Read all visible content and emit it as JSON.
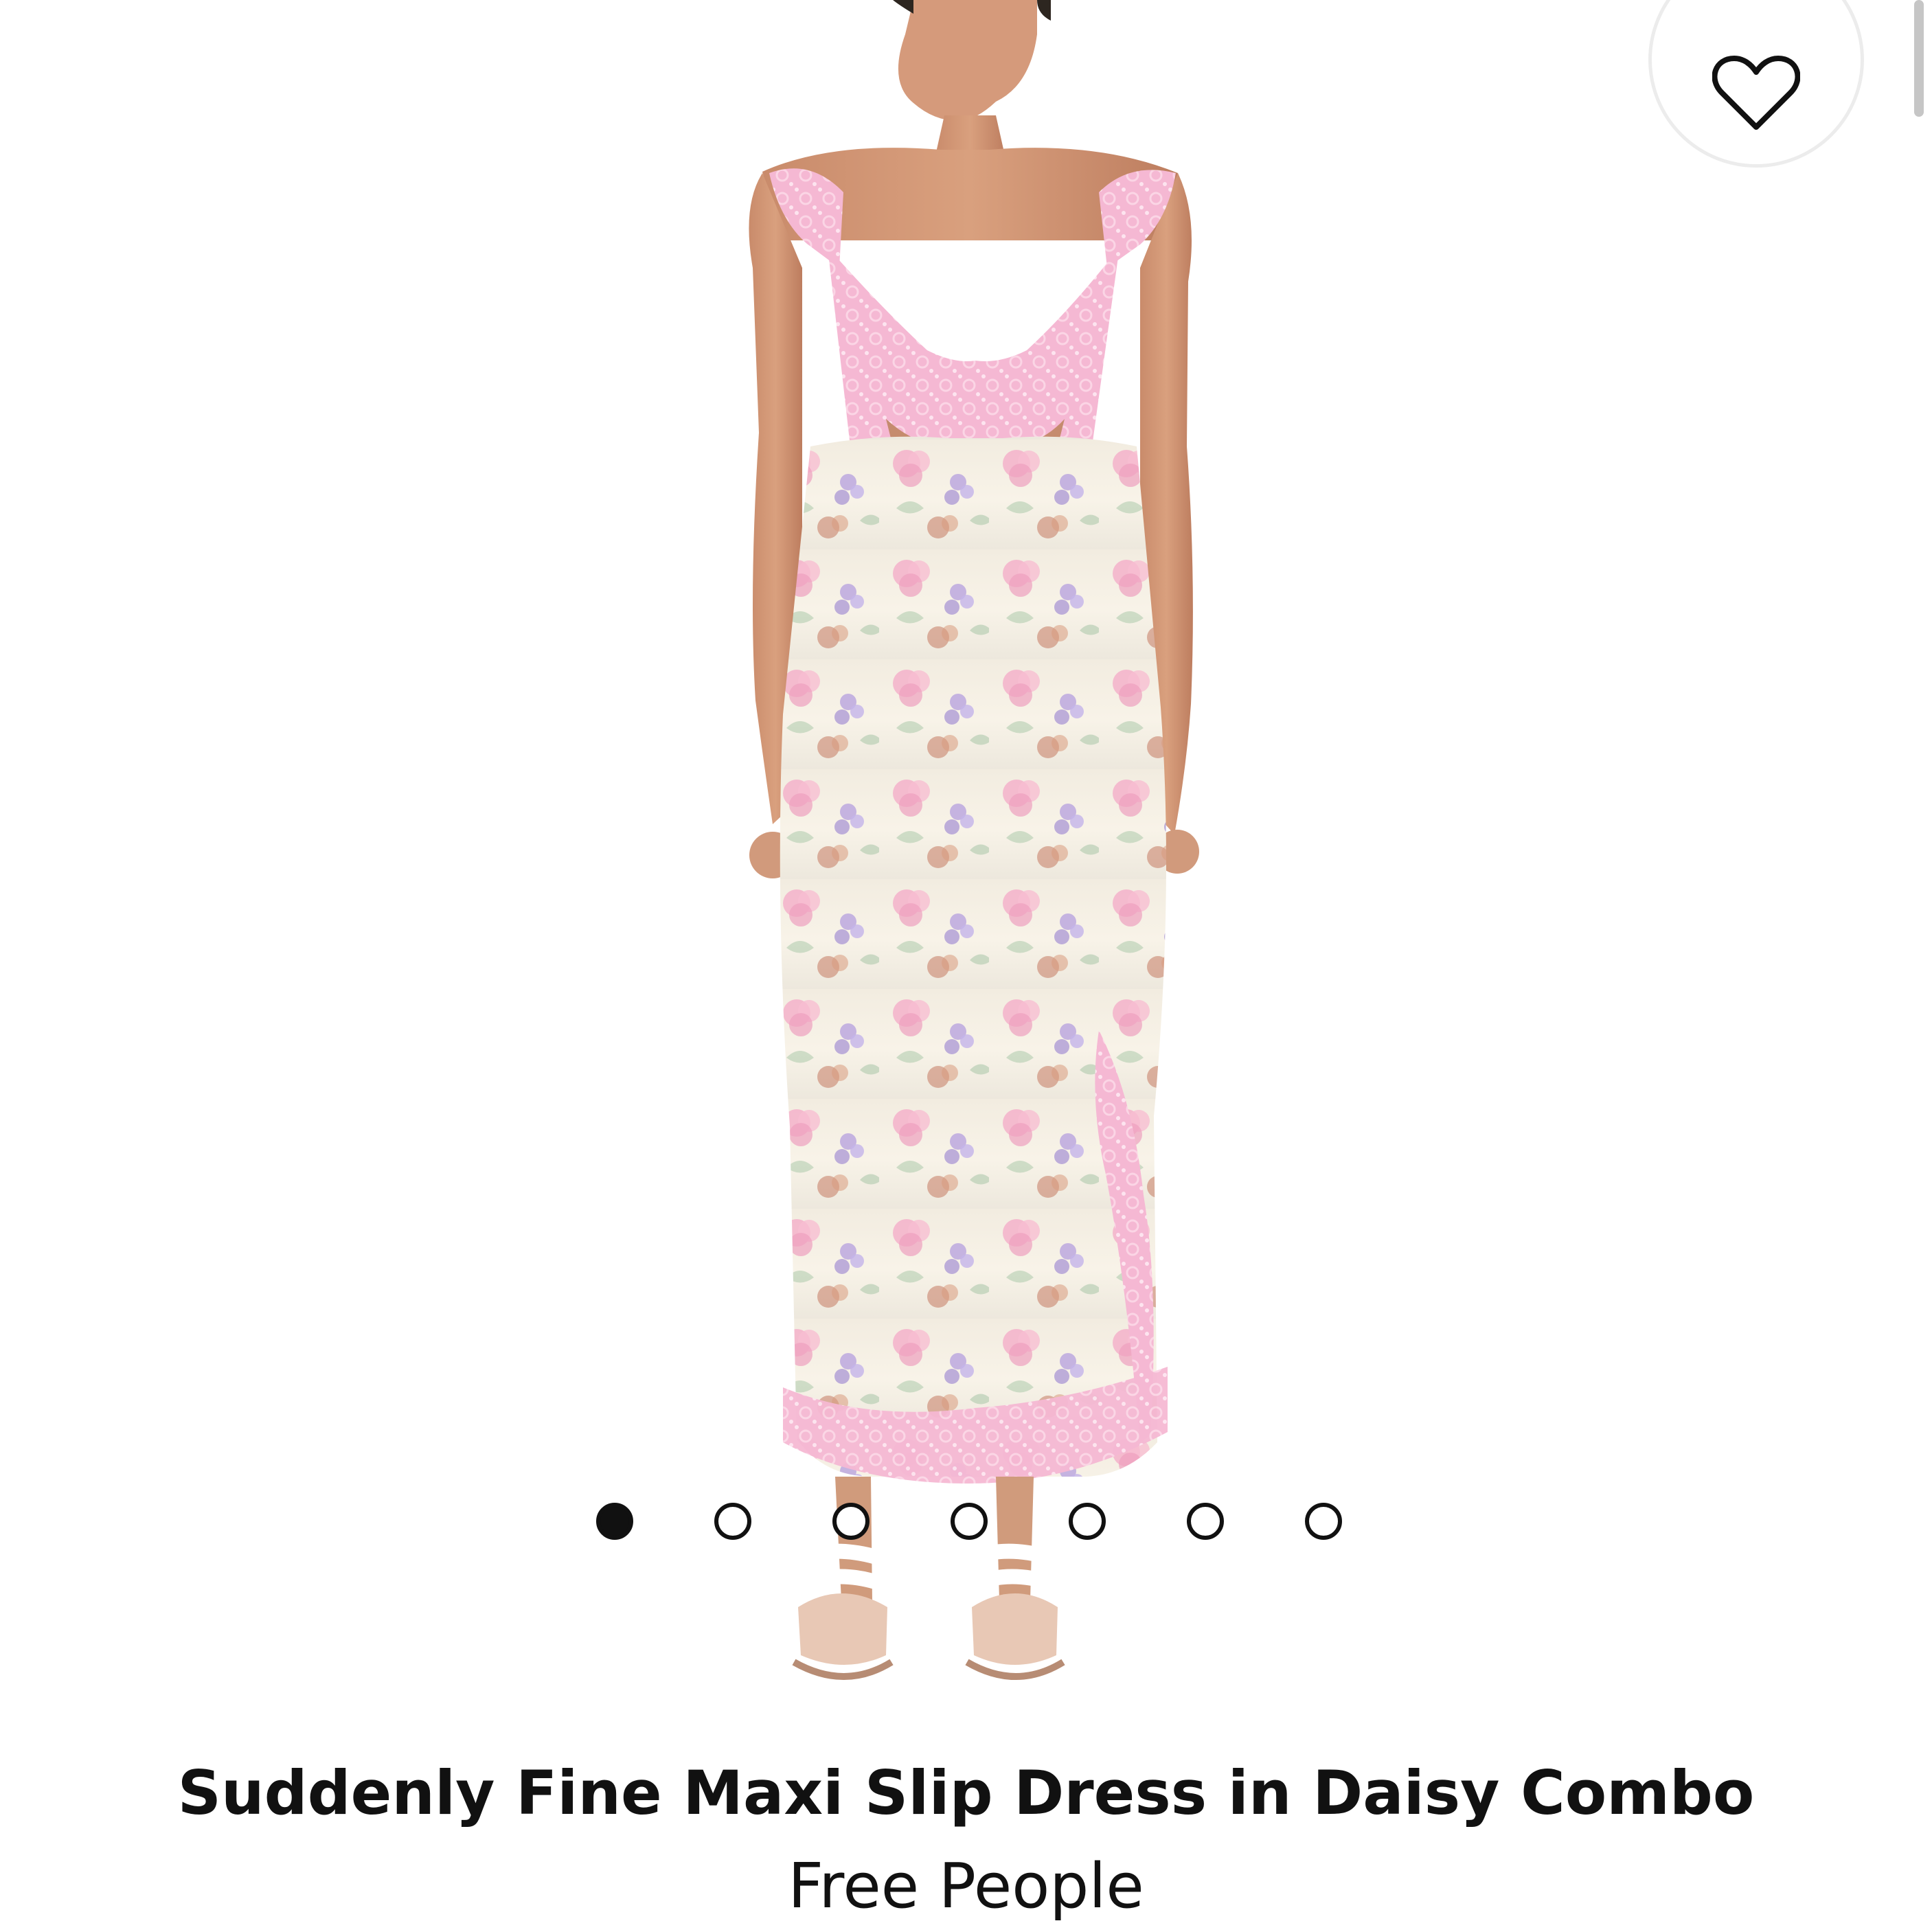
{
  "product": {
    "title": "Suddenly Fine Maxi Slip Dress in Daisy Combo",
    "brand": "Free People"
  },
  "gallery": {
    "image_count": 7,
    "active_index": 0
  },
  "icons": {
    "wishlist": "heart-outline-icon"
  },
  "colors": {
    "lace_pink": "#f4b6d1",
    "floral_cream": "#f7f1e2",
    "text": "#111111",
    "divider": "#ececec"
  }
}
